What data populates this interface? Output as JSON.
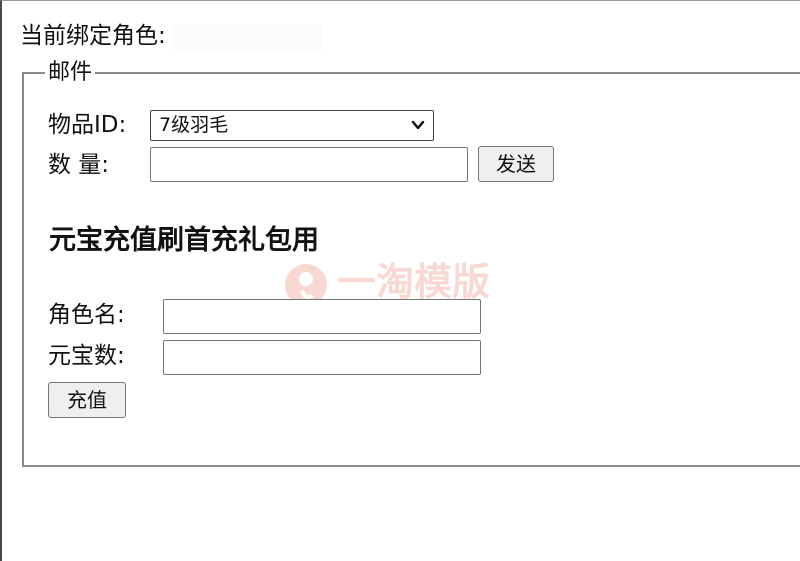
{
  "header": {
    "bound_role_label": "当前绑定角色:"
  },
  "mail": {
    "legend": "邮件",
    "item_id_label": "物品ID:",
    "item_selected": "7级羽毛",
    "quantity_label": "数 量:",
    "quantity_value": "",
    "send_button": "发送"
  },
  "recharge": {
    "title": "元宝充值刷首充礼包用",
    "role_name_label": "角色名:",
    "role_name_value": "",
    "yuanbao_label": "元宝数:",
    "yuanbao_value": "",
    "submit_button": "充值"
  },
  "watermark": {
    "text": "一淘模版"
  },
  "icons": {
    "dropdown": "chevron-down-icon",
    "watermark_logo": "logo-icon"
  }
}
